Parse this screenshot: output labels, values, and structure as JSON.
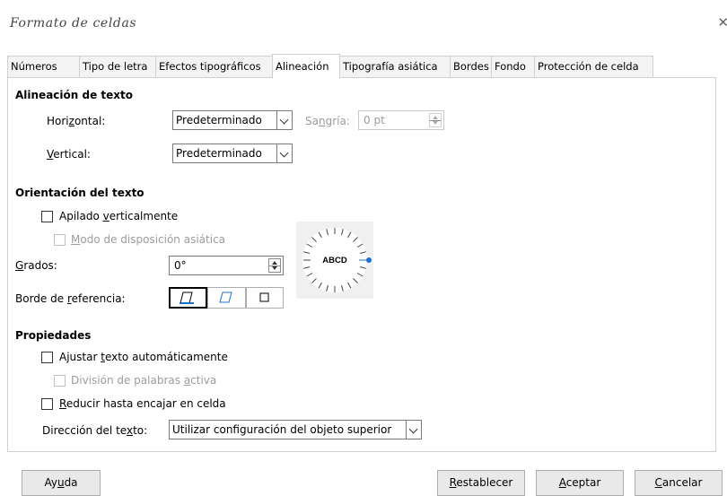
{
  "window": {
    "title": "Formato de celdas",
    "close_glyph": "✕"
  },
  "tabs": [
    {
      "label": "Números"
    },
    {
      "label": "Tipo de letra"
    },
    {
      "label": "Efectos tipográficos"
    },
    {
      "label": "Alineación"
    },
    {
      "label": "Tipografía asiática"
    },
    {
      "label": "Bordes"
    },
    {
      "label": "Fondo"
    },
    {
      "label": "Protección de celda"
    }
  ],
  "active_tab": "Alineación",
  "text_alignment": {
    "heading": "Alineación de texto",
    "horizontal": {
      "label_pre": "Hori",
      "label_u": "z",
      "label_post": "ontal:",
      "value": "Predeterminado"
    },
    "indent": {
      "label_pre": "Sa",
      "label_u": "n",
      "label_post": "gría:",
      "value": "0 pt"
    },
    "vertical": {
      "label_u": "V",
      "label_post": "ertical:",
      "value": "Predeterminado"
    }
  },
  "text_orientation": {
    "heading": "Orientación del texto",
    "stacked": {
      "label_pre": "Apilado ",
      "label_u": "v",
      "label_post": "erticalmente",
      "checked": false
    },
    "asian_layout": {
      "label_u": "M",
      "label_post": "odo de disposición asiática",
      "checked": false
    },
    "degrees": {
      "label_u": "G",
      "label_post": "rados:",
      "value": "0°"
    },
    "reference_edge": {
      "label_pre": "Borde de ",
      "label_u": "r",
      "label_post": "eferencia:"
    },
    "dial_text": "ABCD",
    "dial_accent": "#1f6fd0"
  },
  "properties": {
    "heading": "Propiedades",
    "wrap": {
      "label_pre": "Ajustar ",
      "label_u": "t",
      "label_post": "exto automáticamente",
      "checked": false
    },
    "hyphenation": {
      "label_pre": "División de palabras ",
      "label_u": "a",
      "label_post": "ctiva",
      "checked": false
    },
    "shrink": {
      "label_u": "R",
      "label_post": "educir hasta encajar en celda",
      "checked": false
    },
    "direction": {
      "label_pre": "Dirección del te",
      "label_u": "x",
      "label_post": "to:",
      "value": "Utilizar configuración del objeto superior"
    }
  },
  "buttons": {
    "help": {
      "pre": "Ay",
      "u": "u",
      "post": "da"
    },
    "reset": {
      "u": "R",
      "post": "establecer"
    },
    "ok": {
      "u": "A",
      "post": "ceptar"
    },
    "cancel": {
      "u": "C",
      "post": "ancelar"
    }
  }
}
